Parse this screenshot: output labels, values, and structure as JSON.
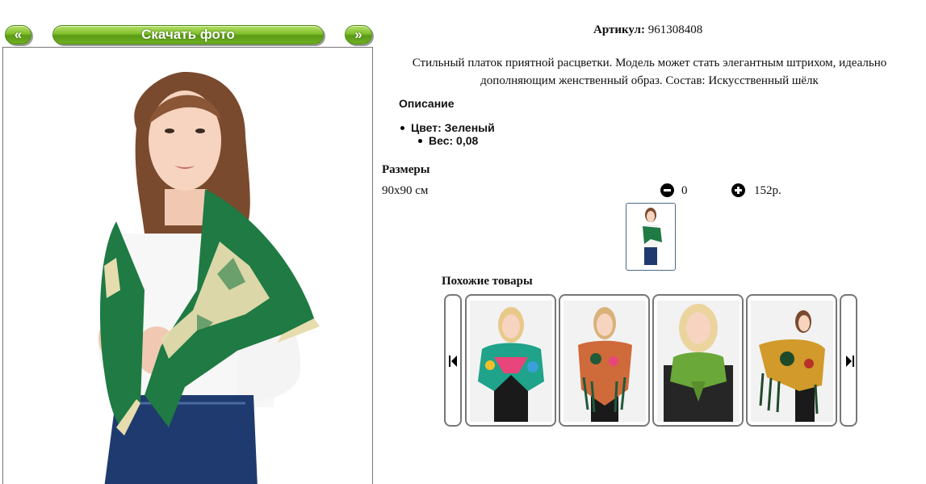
{
  "nav": {
    "prev_label": "«",
    "download_label": "Скачать фото",
    "next_label": "»"
  },
  "product": {
    "article_label": "Артикул:",
    "article_value": "961308408",
    "description": "Стильный платок приятной расцветки. Модель может стать элегантным штрихом, идеально дополняющим женственный образ. Состав: Искусственный шёлк",
    "props_title": "Описание",
    "props": [
      {
        "text": "Цвет: Зеленый"
      },
      {
        "text": "Вес: 0,08"
      }
    ]
  },
  "sizes": {
    "title": "Размеры",
    "rows": [
      {
        "name": "90х90 см",
        "qty": "0",
        "price": "152р."
      }
    ]
  },
  "similar": {
    "title": "Похожие товары",
    "items": [
      {
        "scarf_color": "#1fa38a",
        "accent_color": "#e8457a"
      },
      {
        "scarf_color": "#cf6a3a",
        "accent_color": "#1f5a3a"
      },
      {
        "scarf_color": "#6aa83a",
        "accent_color": "#5b8f2e"
      },
      {
        "scarf_color": "#d19a2a",
        "accent_color": "#1f4a2a"
      }
    ]
  },
  "colors": {
    "button_green": "#7fbf2a",
    "main_scarf": "#1f7a43",
    "scarf_trim": "#e6dcae"
  }
}
